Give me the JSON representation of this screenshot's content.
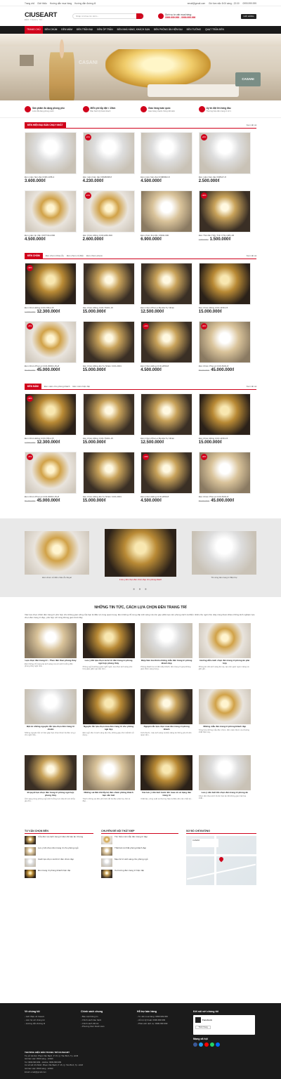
{
  "topbar": {
    "links": [
      "Trang chủ",
      "Giới thiệu",
      "Hướng dẫn mua hàng",
      "Hướng dẫn đường đi"
    ],
    "email": "email@gmail.com",
    "hours": "Giờ làm việc 8:00 sáng - 22:00",
    "phone": "0999.999.999"
  },
  "header": {
    "logo_main": "CIUSEART",
    "logo_sub": "ĐÈN TRANG TRÍ",
    "search_placeholder": "Nhập từ khóa tìm kiếm...",
    "hotline_label": "Dịch vụ tư vấn mua hàng:",
    "hotline_numbers": "0999.999.999 - 0999.999.999",
    "cart_label": "GIỎ HÀNG"
  },
  "nav": [
    "TRANG CHỦ",
    "ĐÈN CHÙM",
    "ĐÈN MÂM",
    "ĐÈN TRẦN ĐẠI",
    "ĐÈN ỐP TRẦN",
    "ĐÈN NHÀ HÀNG, KHÁCH SẠN",
    "ĐÈN PHÒNG ĂN HIỆN ĐẠI",
    "ĐÈN TƯỜNG",
    "QUẠT TRẦN ĐÈN"
  ],
  "banner": {
    "watermark": "CASANI",
    "badge": "CASANI"
  },
  "features": [
    {
      "title": "Sản phẩm đa dạng phong phú",
      "desc": "Luôn đổi dáng phong cách"
    },
    {
      "title": "Miễn phí lắp đặt < 10km",
      "desc": "Bảo hành kỹ thuật nhanh"
    },
    {
      "title": "Giao hàng toàn quốc",
      "desc": "Giao hàng nhanh chóng tiết kiệm"
    },
    {
      "title": "Uy tín đặt lên hàng đầu",
      "desc": "Thương hiệu đèn trang trí số 1"
    }
  ],
  "sections": [
    {
      "title": "ĐÈN HIỆN ĐẠI BÁN CHẠY NHẤT",
      "subs": [],
      "more": "Xem tất cả",
      "products": [
        {
          "sale": "",
          "name": "Đèn mâm hiện đại CNM-1158-4",
          "old": "",
          "price": "3.600.000₫"
        },
        {
          "sale": "-20%",
          "name": "Đèn mâm hiện đại CNM6098-8",
          "old": "",
          "price": "4.230.000₫"
        },
        {
          "sale": "",
          "name": "Đèn mâm hiện đại CNM8302-8",
          "old": "",
          "price": "4.500.000₫"
        },
        {
          "sale": "-20%",
          "name": "Đèn mâm hiện đại CM8117-8",
          "old": "",
          "price": "2.500.000₫"
        },
        {
          "sale": "",
          "name": "Đèn mâm ốp trần CMT7314-800",
          "old": "",
          "price": "4.500.000₫"
        },
        {
          "sale": "-10%",
          "name": "Đèn Chùm Đồng CCD1260-600",
          "old": "",
          "price": "2.600.000₫"
        },
        {
          "sale": "",
          "name": "Đèn chùm thả trần CNM2-600",
          "old": "",
          "price": "6.900.000₫"
        },
        {
          "sale": "-30%",
          "name": "Đèn Thả trần Thủy Tinh CTH-1481-36",
          "old": "1.900.000₫",
          "price": "1.500.000₫"
        }
      ]
    },
    {
      "title": "ĐÈN CHÙM",
      "subs": [
        "Đèn chùm Châu Âu",
        "Đèn chùm cổ điển",
        "Đèn chùm pha lê"
      ],
      "more": "Xem tất cả",
      "products": [
        {
          "sale": "-30%",
          "name": "Đèn Chùm Đồng CCD-7811-15",
          "old": "14.500.000₫",
          "price": "12.300.000₫"
        },
        {
          "sale": "",
          "name": "Đèn Chùm Đồng CCD-76161-15",
          "old": "",
          "price": "15.000.000₫"
        },
        {
          "sale": "",
          "name": "Đèn Chùm Pha Lê Bọt Đá Tự Nhiên",
          "old": "",
          "price": "12.500.000₫"
        },
        {
          "sale": "",
          "name": "Đèn Chùm Đồng CCD-1150-15",
          "old": "",
          "price": "15.000.000₫"
        },
        {
          "sale": "-25%",
          "name": "Đèn Chùm Pha Lê CCD-30016-15+8",
          "old": "55.000.000₫",
          "price": "45.000.000₫"
        },
        {
          "sale": "",
          "name": "Đèn Chùm Đồng Đá Tự Nhiên CCD-2001",
          "old": "",
          "price": "15.000.000₫"
        },
        {
          "sale": "-20%",
          "name": "Đèn Chùm Đồng CCD-2050-8",
          "old": "",
          "price": "4.500.000₫"
        },
        {
          "sale": "-30%",
          "name": "Đèn Chùm Pha Lê CCD-8101-8",
          "old": "55.000.000₫",
          "price": "45.000.000₫"
        }
      ]
    },
    {
      "title": "ĐÈN MÂM",
      "subs": [
        "Đèn mâm cho phòng khách",
        "Đèn mâm hiện đại"
      ],
      "more": "Xem tất cả",
      "products": [
        {
          "sale": "-30%",
          "name": "Đèn Chùm Đồng CCD-7811-15",
          "old": "14.500.000₫",
          "price": "12.300.000₫"
        },
        {
          "sale": "",
          "name": "Đèn Chùm Đồng CCD-76161-15",
          "old": "",
          "price": "15.000.000₫"
        },
        {
          "sale": "",
          "name": "Đèn Chùm Pha Lê Bọt Đá Tự Nhiên",
          "old": "",
          "price": "12.500.000₫"
        },
        {
          "sale": "",
          "name": "Đèn Chùm Đồng CCD-1150-15",
          "old": "",
          "price": "15.000.000₫"
        },
        {
          "sale": "-25%",
          "name": "Đèn Chùm Pha Lê CCD-30016-15+8",
          "old": "55.000.000₫",
          "price": "45.000.000₫"
        },
        {
          "sale": "",
          "name": "Đèn Chùm Đồng Đá Tự Nhiên CCD-2001",
          "old": "",
          "price": "15.000.000₫"
        },
        {
          "sale": "-20%",
          "name": "Đèn Chùm Đồng CCD-2050-8",
          "old": "",
          "price": "4.500.000₫"
        },
        {
          "sale": "-30%",
          "name": "Đèn Chùm Pha Lê CCD-8101-8",
          "old": "55.000.000₫",
          "price": "45.000.000₫"
        }
      ]
    }
  ],
  "showcase": {
    "captions": [
      "Đèn chùm cổ điển châu Âu Royal",
      "4 lưu ý khi chọn đèn chùm đẹp cho phòng khách",
      "Thi công đèn trang trí Biệt thự"
    ],
    "dots": "● ● ●"
  },
  "news": {
    "title": "NHỮNG TIN TỨC, CÁCH LỰA CHỌN ĐÈN TRANG TRÍ",
    "intro": "Việc lựa chọn chiếc đèn trang trí phù hợp cho không gian sống của bạn là điều vô cùng quan trọng. Đèn không chỉ cung cấp ánh sáng mà còn góp phần tạo nên phong cách và điểm nhấn cho ngôi nhà. Hãy cùng tham khảo những kinh nghiệm lựa chọn đèn trang trí đẹp, phù hợp với từng không gian dưới đây.",
    "items": [
      {
        "title": "Lựa chọn đèn trang trí – Theo đèn theo phong thủy",
        "desc": "Đèn không chỉ mang lại ánh sáng mà còn ảnh hưởng đến phong thủy ngôi nhà..."
      },
      {
        "title": "Lưu ý khi lựa chọn và bố trí đèn trang trí phòng ngủ hợp phong thủy",
        "desc": "Phòng ngủ là không gian nghỉ ngơi, lựa chọn ánh sáng phù hợp giúp giấc ngủ sâu hơn..."
      },
      {
        "title": "Điệp Sản lưu thêm những mẫu đèn trang trí phòng khách đẹp",
        "desc": "Phòng khách là nơi đón tiếp khách, đèn trang trí giúp không gian thêm sang trọng..."
      },
      {
        "title": "Hướng dẫn cách chọn đèn trang trí phòng ăn phù hợp",
        "desc": "Phòng ăn cần ánh sáng ấm áp, tạo cảm giác ngon miệng và gần gũi..."
      },
      {
        "title": "Bật mí những nguyên tắc lựa chọn đèn trang trí chuẩn",
        "desc": "Những nguyên tắc cơ bản giúp bạn chọn được bộ đèn ưng ý cho ngôi nhà..."
      },
      {
        "title": "Nguyên tắc lựa chọn mua đèn trang trí cho phòng ngủ đẹp",
        "desc": "Đèn ngủ cần có ánh sáng dịu nhẹ, không gây chói mắt khi sử dụng..."
      },
      {
        "title": "Nguyên tắc lựa chọn mua đèn trang trí phòng khách",
        "desc": "Kích thước, màu ánh sáng và kiểu dáng là những yếu tố cần quan tâm..."
      },
      {
        "title": "Những mẫu đèn trang trí phòng khách đẹp",
        "desc": "Tổng hợp những mẫu đèn chùm, đèn mâm được ưa chuộng nhất hiện nay..."
      },
      {
        "title": "Bí quyết lựa chọn đèn trang trí phòng ngủ hợp phong thủy",
        "desc": "Ánh sáng trong phòng ngủ ảnh hưởng trực tiếp tới sức khỏe gia chủ..."
      },
      {
        "title": "Những sai lầm khi lắp bộ đèn chùm phòng khách bạn cần biết",
        "desc": "Tránh những sai lầm phổ biến để bộ đèn phát huy hết vẻ đẹp..."
      },
      {
        "title": "Các lưu ý cần biết trước khi mua và sử dụng đèn trang trí",
        "desc": "Chất liệu, công suất và thương hiệu là điều cần cân nhắc kỹ..."
      },
      {
        "title": "Lưu ý cần biết khi chọn đèn trang trí phòng ăn",
        "desc": "Chọn đèn theo kích thước bàn ăn để không gian hài hòa nhất..."
      }
    ]
  },
  "bottom": {
    "col1_title": "TƯ VẤN CHỌN ĐÈN",
    "col1": [
      "Cửa đèn và cách trang trí Đèn lối bàn ăn 3 bóng",
      "Lưu ý khi chọn đèn trang trí cho phòng ngủ",
      "Cách lựa chọn và bố trí đèn chùm đẹp",
      "Đèn trang trí phòng khách hiện đại"
    ],
    "col2_title": "CHUYÊN ĐỀ NỘI THẤT ĐẸP",
    "col2": [
      "Tìm hiểu một mẫu đèn trang trí đẹp",
      "Thiết kế nội thất phòng khách đẹp",
      "Mẹo bố trí ánh sáng cho phòng ngủ",
      "Xu hướng đèn trang trí hiện đại"
    ],
    "col3_title": "SƠ ĐỒ CHỈ ĐƯỜNG",
    "map_label": "CASANI"
  },
  "footer": {
    "col1_title": "Về chúng tôi",
    "col1": [
      "Giới thiệu về Casani",
      "Liên hệ với chúng tôi",
      "Hướng dẫn đường đi"
    ],
    "col2_title": "Chính sách chung",
    "col2": [
      "Bảo mật thông tin",
      "Chính sách bảo hành",
      "Chính sách đổi trả",
      "Phương thức thanh toán"
    ],
    "col3_title": "Hỗ trợ bán hàng",
    "col3": [
      "Tư vấn mua hàng: 0999.999.999",
      "Hỗ trợ kỹ thuật: 0999.999.999",
      "Phản ánh dịch vụ: 0999.999.999"
    ],
    "col4_title": "Kết nối với chúng tôi",
    "fb_name": "Facebook",
    "fb_button": "Thích Trang",
    "social_title": "Mạng xã hội",
    "company": "THƯƠNG HIỆU ĐÈN TRANG TRÍ CIUSEART",
    "addr1": "Trụ sở Hà Nội: Phạm Văn Bạch, P. 15, Q. Tân Bình, Tp. HCM",
    "time1": "Giờ làm việc: 8h00 sáng - 22h00",
    "tel1": "Tel: 0999.999.999 - Hotline: 0999.999.999",
    "addr2": "Cơ sở Hồ Chí Minh: Phạm Văn Bạch, P. 15, Q. Tân Bình, Tp. HCM",
    "time2": "Giờ làm việc: 8h00 sáng - 22h00",
    "email": "Email: email@gmail.com"
  }
}
